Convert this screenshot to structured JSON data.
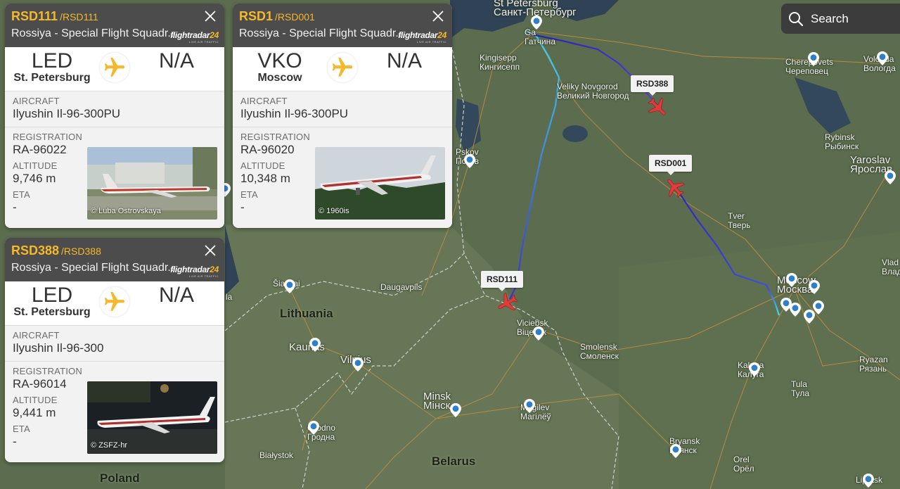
{
  "search": {
    "label": "Search"
  },
  "map": {
    "countries": [
      {
        "name": "Lithuania"
      },
      {
        "name": "Belarus"
      },
      {
        "name": "Poland"
      }
    ],
    "cities": [
      {
        "name": "St Petersburg",
        "alt": "Санкт-Петербург"
      },
      {
        "name": "Ga",
        "alt": "Гатчина"
      },
      {
        "name": "Kingisepp",
        "alt": "Кингисепп"
      },
      {
        "name": "Veliky Novgorod",
        "alt": "Великий Новгород"
      },
      {
        "name": "Cherepovets",
        "alt": "Череповец"
      },
      {
        "name": "Vologda",
        "alt": "Вологда"
      },
      {
        "name": "Rybinsk",
        "alt": "Рыбинск"
      },
      {
        "name": "Yaroslav",
        "alt": "Ярослав"
      },
      {
        "name": "Pskov",
        "alt": "Псков"
      },
      {
        "name": "Tver",
        "alt": "Тверь"
      },
      {
        "name": "Moscow",
        "alt": "Москва"
      },
      {
        "name": "Vlad",
        "alt": "Влад"
      },
      {
        "name": "Šiauliai",
        "alt": ""
      },
      {
        "name": "Daugavpils",
        "alt": ""
      },
      {
        "name": "Viciebsk",
        "alt": "Віцебск"
      },
      {
        "name": "Smolensk",
        "alt": "Смоленск"
      },
      {
        "name": "Kaunas",
        "alt": ""
      },
      {
        "name": "Vilnius",
        "alt": ""
      },
      {
        "name": "Kaluga",
        "alt": "Калуга"
      },
      {
        "name": "Tula",
        "alt": "Тула"
      },
      {
        "name": "Ryazan",
        "alt": "Рязань"
      },
      {
        "name": "Minsk",
        "alt": "Мінск"
      },
      {
        "name": "Mogilev",
        "alt": "Магілёў"
      },
      {
        "name": "Grodno",
        "alt": "Гродна"
      },
      {
        "name": "Białystok",
        "alt": ""
      },
      {
        "name": "Bryansk",
        "alt": "Брянск"
      },
      {
        "name": "Orel",
        "alt": "Орёл"
      },
      {
        "name": "Lipetsk",
        "alt": "Липецк"
      },
      {
        "name": "la",
        "alt": ""
      }
    ],
    "flight_tags": [
      {
        "label": "RSD388"
      },
      {
        "label": "RSD001"
      },
      {
        "label": "RSD111"
      }
    ]
  },
  "cards": [
    {
      "callsign": "RSD111",
      "callsign_sub": "/RSD111",
      "airline": "Rossiya - Special Flight Squadr...",
      "logo_main": "flightradar",
      "logo_num": "24",
      "logo_sub": "LIVE AIR TRAFFIC",
      "from_code": "LED",
      "from_city": "St. Petersburg",
      "to_code": "N/A",
      "aircraft_label": "AIRCRAFT",
      "aircraft": "Ilyushin Il-96-300PU",
      "registration_label": "REGISTRATION",
      "registration": "RA-96022",
      "altitude_label": "ALTITUDE",
      "altitude": "9,746 m",
      "eta_label": "ETA",
      "eta": "-",
      "photo_credit": "© Luba Ostrovskaya"
    },
    {
      "callsign": "RSD1",
      "callsign_sub": "/RSD001",
      "airline": "Rossiya - Special Flight Squadr...",
      "logo_main": "flightradar",
      "logo_num": "24",
      "logo_sub": "LIVE AIR TRAFFIC",
      "from_code": "VKO",
      "from_city": "Moscow",
      "to_code": "N/A",
      "aircraft_label": "AIRCRAFT",
      "aircraft": "Ilyushin Il-96-300PU",
      "registration_label": "REGISTRATION",
      "registration": "RA-96020",
      "altitude_label": "ALTITUDE",
      "altitude": "10,348 m",
      "eta_label": "ETA",
      "eta": "-",
      "photo_credit": "© 1960is"
    },
    {
      "callsign": "RSD388",
      "callsign_sub": "/RSD388",
      "airline": "Rossiya - Special Flight Squadr...",
      "logo_main": "flightradar",
      "logo_num": "24",
      "logo_sub": "LIVE AIR TRAFFIC",
      "from_code": "LED",
      "from_city": "St. Petersburg",
      "to_code": "N/A",
      "aircraft_label": "AIRCRAFT",
      "aircraft": "Ilyushin Il-96-300",
      "registration_label": "REGISTRATION",
      "registration": "RA-96014",
      "altitude_label": "ALTITUDE",
      "altitude": "9,441 m",
      "eta_label": "ETA",
      "eta": "-",
      "photo_credit": "© ZSFZ-hr"
    }
  ],
  "colors": {
    "accent": "#f6b82b",
    "header": "#4c4c4c",
    "plane_red": "#e23b3b",
    "track_start": "#40d8f0",
    "track_end": "#3a2fd0"
  }
}
